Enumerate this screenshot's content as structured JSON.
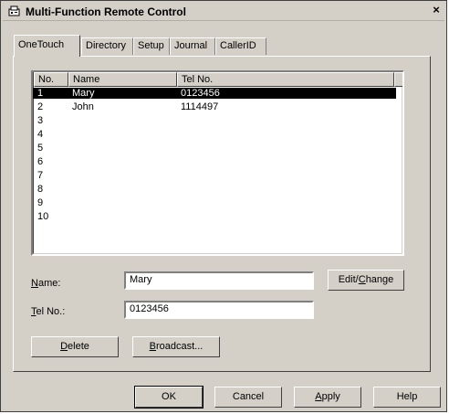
{
  "window": {
    "title": "Multi-Function Remote Control",
    "close_glyph": "×"
  },
  "tabs": [
    "OneTouch",
    "Directory",
    "Setup",
    "Journal",
    "CallerID"
  ],
  "list": {
    "columns": [
      "No.",
      "Name",
      "Tel No."
    ],
    "rows": [
      {
        "no": "1",
        "name": "Mary",
        "tel": "0123456"
      },
      {
        "no": "2",
        "name": "John",
        "tel": "1114497"
      },
      {
        "no": "3",
        "name": "",
        "tel": ""
      },
      {
        "no": "4",
        "name": "",
        "tel": ""
      },
      {
        "no": "5",
        "name": "",
        "tel": ""
      },
      {
        "no": "6",
        "name": "",
        "tel": ""
      },
      {
        "no": "7",
        "name": "",
        "tel": ""
      },
      {
        "no": "8",
        "name": "",
        "tel": ""
      },
      {
        "no": "9",
        "name": "",
        "tel": ""
      },
      {
        "no": "10",
        "name": "",
        "tel": ""
      }
    ],
    "selected_index": 0
  },
  "form": {
    "name_label_mnemonic": "N",
    "name_label_rest": "ame:",
    "name_value": "Mary",
    "tel_label_mnemonic": "T",
    "tel_label_rest": "el No.:",
    "tel_value": "0123456",
    "edit_pre": "Edit/",
    "edit_mnemonic": "C",
    "edit_post": "hange",
    "delete_mnemonic": "D",
    "delete_rest": "elete",
    "broadcast_mnemonic": "B",
    "broadcast_rest": "roadcast..."
  },
  "footer": {
    "ok": "OK",
    "cancel": "Cancel",
    "apply_mnemonic": "A",
    "apply_rest": "pply",
    "help": "Help"
  },
  "icons": {
    "title": "fax-machine-icon"
  }
}
